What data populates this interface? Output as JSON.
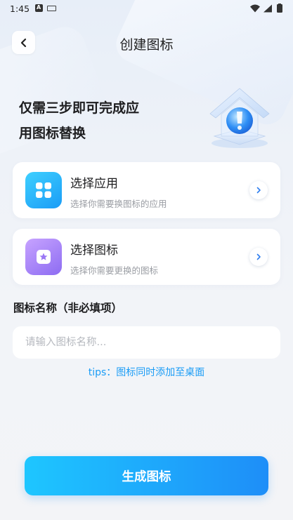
{
  "status_bar": {
    "time": "1:45"
  },
  "header": {
    "title": "创建图标"
  },
  "hero": {
    "line1": "仅需三步即可完成应",
    "line2": "用图标替换"
  },
  "cards": [
    {
      "title": "选择应用",
      "subtitle": "选择你需要换图标的应用",
      "icon": "apps-grid-icon",
      "color": "#1a9cf6"
    },
    {
      "title": "选择图标",
      "subtitle": "选择你需要更换的图标",
      "icon": "star-icon",
      "color": "#8d6cf2"
    }
  ],
  "name_section": {
    "label": "图标名称（非必填项）",
    "placeholder": "请输入图标名称...",
    "value": ""
  },
  "tips": "tips：图标同时添加至桌面",
  "generate_button": {
    "label": "生成图标",
    "color": "#1e8ef8"
  }
}
